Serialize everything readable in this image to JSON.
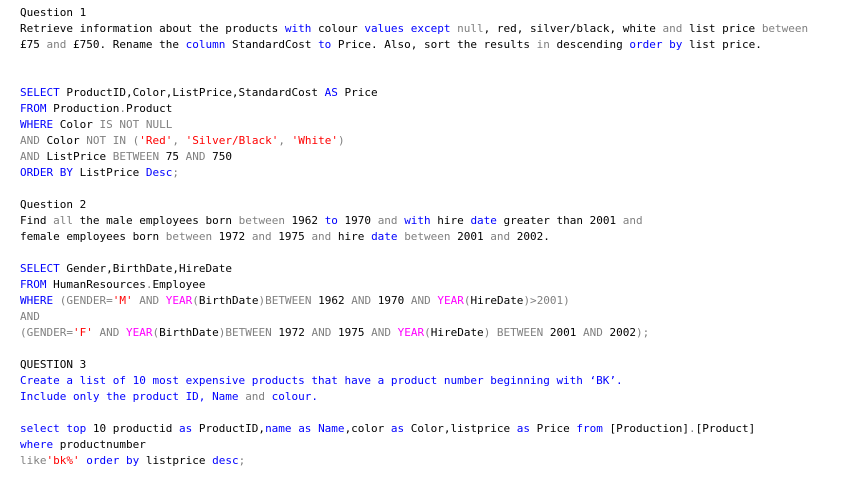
{
  "colors": {
    "keyword": "#0000FF",
    "operator": "#808080",
    "string": "#FF0000",
    "function": "#FF00FF",
    "text": "#000000"
  },
  "q1": {
    "heading": "Question 1",
    "text1": {
      "a": "Retrieve information about the products ",
      "b": "with",
      "c": " colour ",
      "d": "values",
      "e": " ",
      "f": "except",
      "g": " ",
      "h": "null",
      "i": ", red, silver/black, white ",
      "j": "and",
      "k": " list price ",
      "l": "between"
    },
    "text2": {
      "a": "£75 ",
      "b": "and",
      "c": " £750. Rename the ",
      "d": "column",
      "e": " StandardCost ",
      "f": "to",
      "g": " Price. Also, sort the results ",
      "h": "in",
      "i": " descending ",
      "j": "order",
      "k": " ",
      "l": "by",
      "m": " list price."
    },
    "sql": {
      "l1": {
        "a": "SELECT",
        "b": " ProductID,Color,ListPrice,StandardCost ",
        "c": "AS",
        "d": " Price"
      },
      "l2": {
        "a": "FROM",
        "b": " Production",
        ".": ".",
        "c": "Product"
      },
      "l3": {
        "a": "WHERE",
        "b": " Color ",
        "c": "IS NOT NULL"
      },
      "l4": {
        "a": "AND",
        "b": " Color ",
        "c": "NOT IN",
        "d": " (",
        "e": "'Red'",
        "f": ", ",
        "g": "'Silver/Black'",
        "h": ", ",
        "i": "'White'",
        "j": ")"
      },
      "l5": {
        "a": "AND",
        "b": " ListPrice ",
        "c": "BETWEEN",
        "d": " 75 ",
        "e": "AND",
        "f": " 750"
      },
      "l6": {
        "a": "ORDER BY",
        "b": " ListPrice ",
        "c": "Desc",
        ";": ";"
      }
    }
  },
  "q2": {
    "heading": "Question 2",
    "text1": {
      "a": "Find ",
      "b": "all",
      "c": " the male employees born ",
      "d": "between",
      "e": " 1962 ",
      "f": "to",
      "g": " 1970 ",
      "h": "and",
      "i": " ",
      "j": "with",
      "k": " hire ",
      "l": "date",
      "m": " greater than 2001 ",
      "n": "and"
    },
    "text2": {
      "a": "female employees born ",
      "b": "between",
      "c": " 1972 ",
      "d": "and",
      "e": " 1975 ",
      "f": "and",
      "g": " hire ",
      "h": "date",
      "i": " ",
      "j": "between",
      "k": " 2001 ",
      "l": "and",
      "m": " 2002."
    },
    "sql": {
      "l1": {
        "a": "SELECT",
        "b": " Gender,BirthDate,HireDate"
      },
      "l2": {
        "a": "FROM",
        "b": " HumanResources",
        ".": ".",
        "c": "Employee"
      },
      "l3": {
        "a": "WHERE",
        "b": " (GENDER",
        "c": "=",
        "d": "'M'",
        "e": " AND ",
        "f": "YEAR",
        "g": "(",
        "h": "BirthDate",
        "i": ")BETWEEN",
        "j": " 1962 ",
        "k": "AND",
        "l": " 1970 ",
        "m": "AND",
        "n": " ",
        "o": "YEAR",
        "p": "(",
        "q": "HireDate",
        "r": ")>",
        "s": "2001)"
      },
      "l4": {
        "a": "AND"
      },
      "l5": {
        "a": "(GENDER",
        "b": "=",
        "c": "'F'",
        "d": " AND ",
        "e": "YEAR",
        "f": "(",
        "g": "BirthDate",
        "h": ")BETWEEN",
        "i": " 1972 ",
        "j": "AND",
        "k": " 1975 ",
        "l": "AND",
        "m": " ",
        "n": "YEAR",
        "o": "(",
        "p": "HireDate",
        "q": ") BETWEEN",
        "r": " 2001 ",
        "s": "AND",
        "t": " 2002",
        ")": ");"
      }
    }
  },
  "q3": {
    "heading": "QUESTION 3",
    "text1": {
      "a": "Create a list ",
      "b": "of",
      "c": " 10 most expensive products that have a product number beginning ",
      "d": "with",
      "e": " ‘BK’."
    },
    "text2": {
      "a": "Include only the product ID, ",
      "b": "Name",
      "c": " ",
      "d": "and",
      "e": " colour."
    },
    "sql": {
      "l1": {
        "a": "select top",
        "b": " 10 productid ",
        "c": "as",
        "d": " ProductID,",
        "e": "name",
        "f": " ",
        "g": "as",
        "h": " ",
        "i": "Name",
        "j": ",color ",
        "k": "as",
        "l": " Color,listprice ",
        "m": "as",
        "n": " Price ",
        "o": "from",
        "p": " [Production]",
        ".": ".",
        "q": "[Product]"
      },
      "l2": {
        "a": "where",
        "b": " productnumber"
      },
      "l3": {
        "a": "like",
        "b": "'bk%'",
        "c": " ",
        "d": "order by",
        "e": " listprice ",
        "f": "desc",
        ";": ";"
      }
    }
  }
}
